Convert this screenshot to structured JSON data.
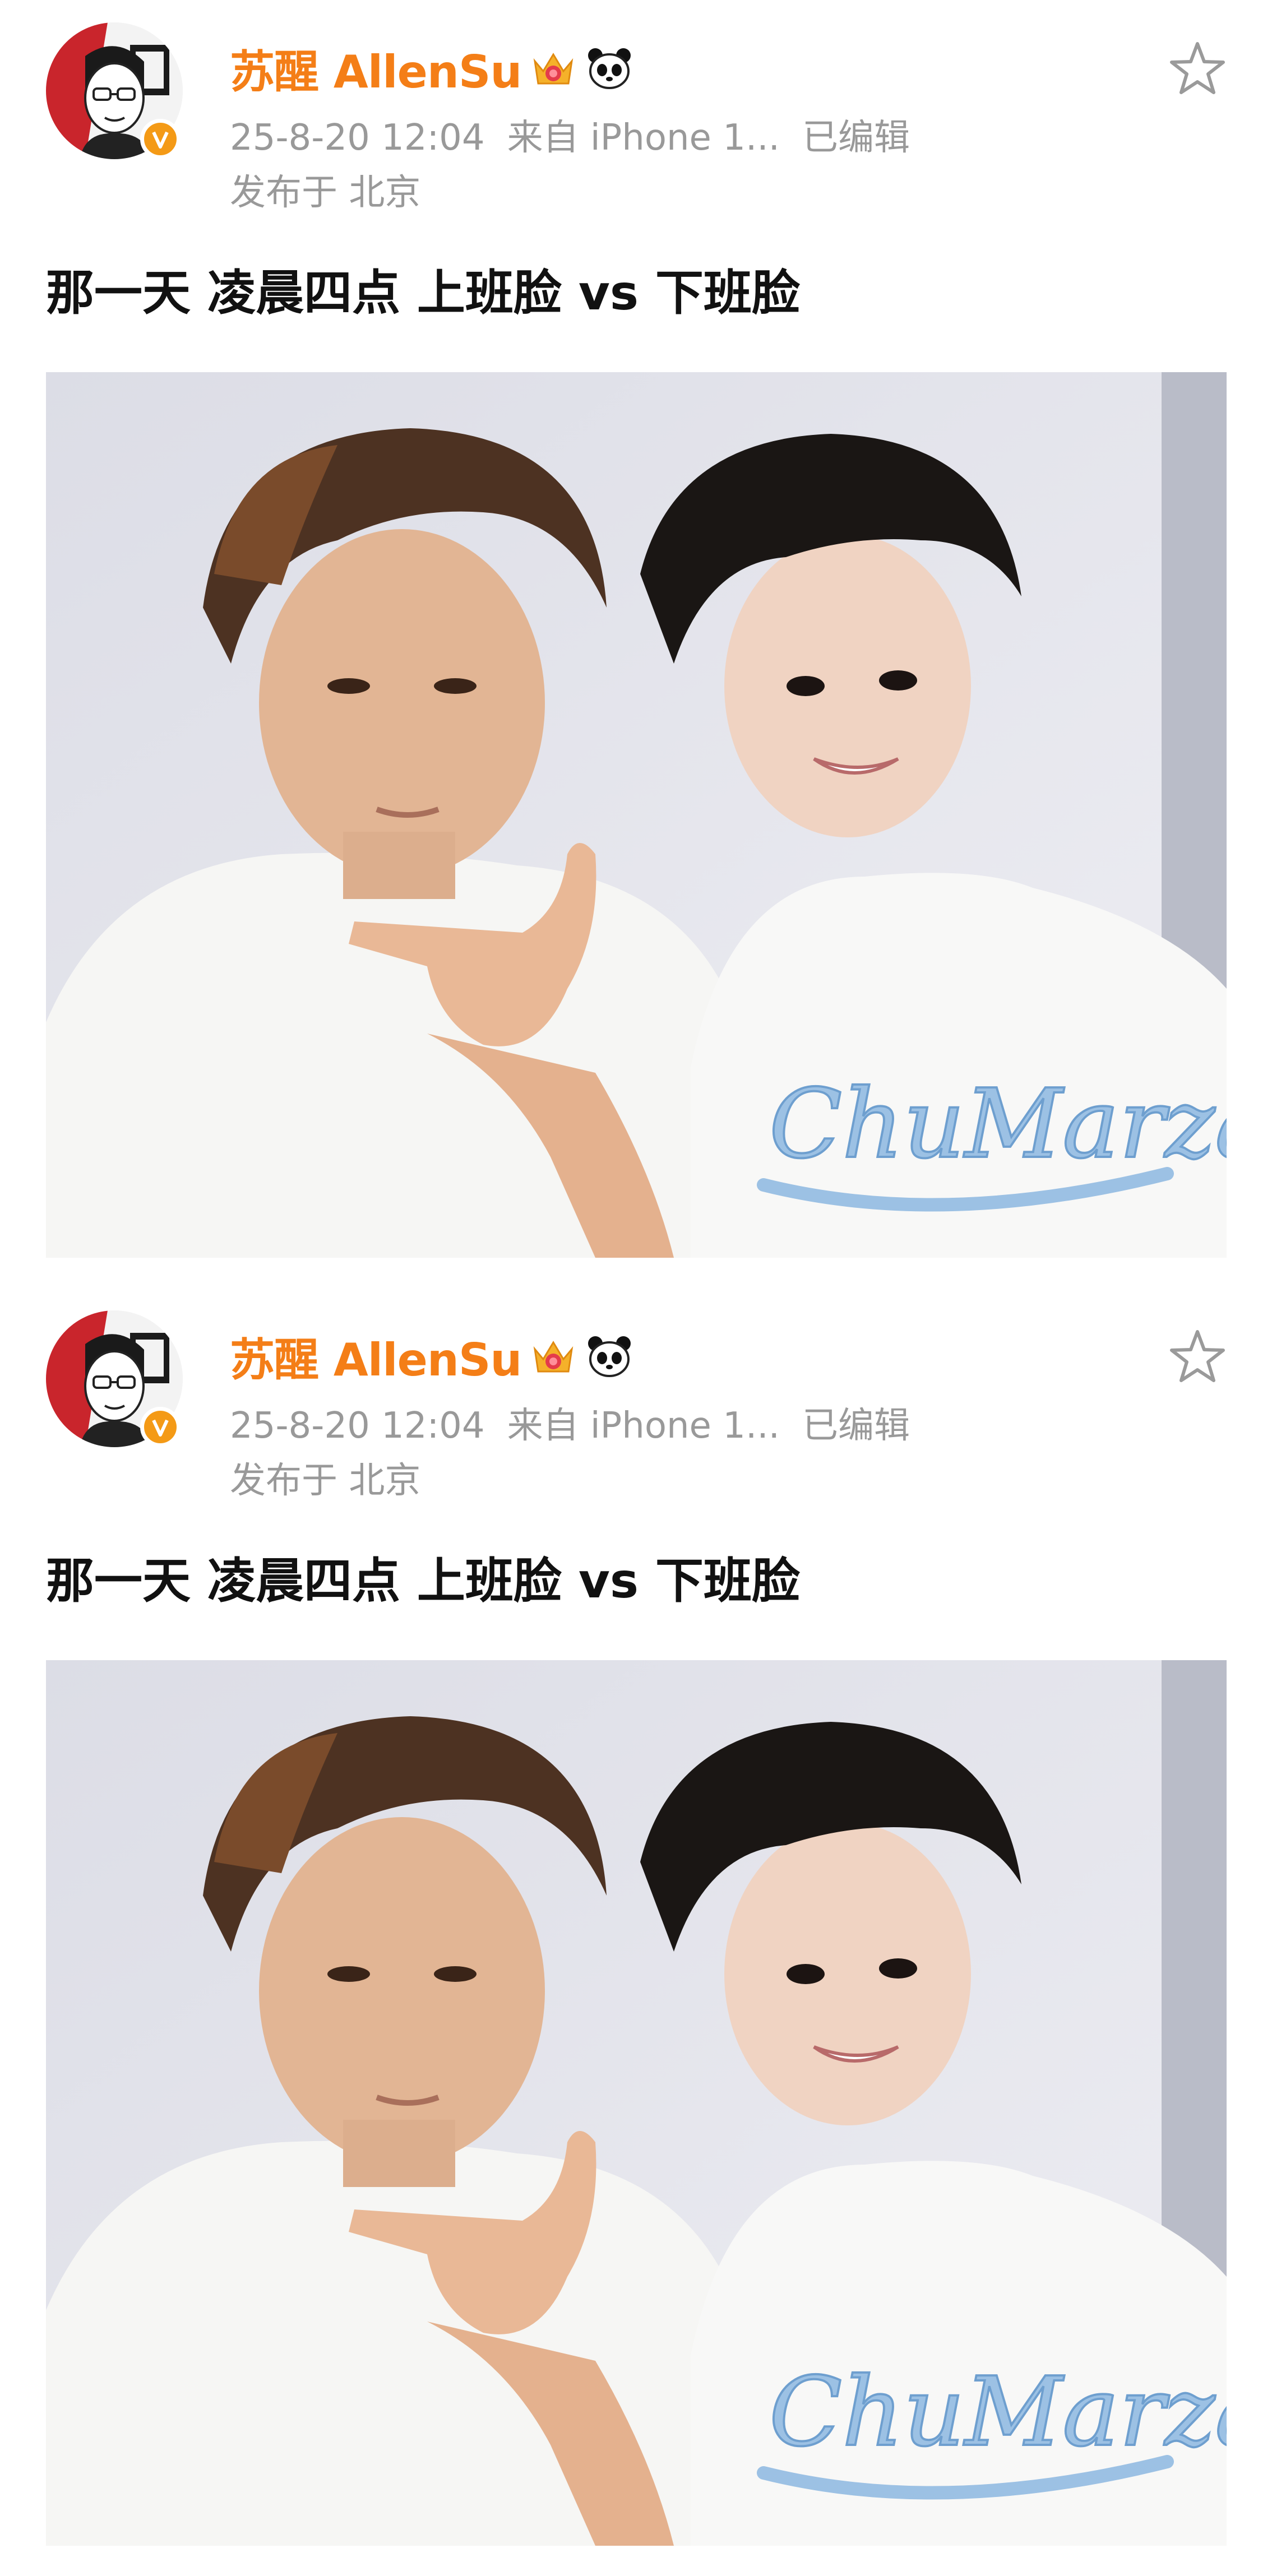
{
  "posts": [
    {
      "author": {
        "name": "苏醒 AllenSu",
        "verified": true,
        "badges": [
          "crown-icon",
          "panda-icon"
        ]
      },
      "meta": {
        "time": "25-8-20 12:04",
        "source": "来自 iPhone 1...",
        "edited": "已编辑"
      },
      "location": "发布于 北京",
      "content": "那一天 凌晨四点 上班脸 vs 下班脸",
      "photo": {
        "shirt_print_text": "ChuMarzao"
      }
    },
    {
      "author": {
        "name": "苏醒 AllenSu",
        "verified": true,
        "badges": [
          "crown-icon",
          "panda-icon"
        ]
      },
      "meta": {
        "time": "25-8-20 12:04",
        "source": "来自 iPhone 1...",
        "edited": "已编辑"
      },
      "location": "发布于 北京",
      "content": "那一天 凌晨四点 上班脸 vs 下班脸",
      "photo": {
        "shirt_print_text": "ChuMarzao"
      }
    }
  ],
  "colors": {
    "accent": "#f47e17",
    "meta_text": "#999999",
    "body_text": "#111111",
    "verified_badge": "#f49a16",
    "star_outline": "#9a9a9a"
  }
}
